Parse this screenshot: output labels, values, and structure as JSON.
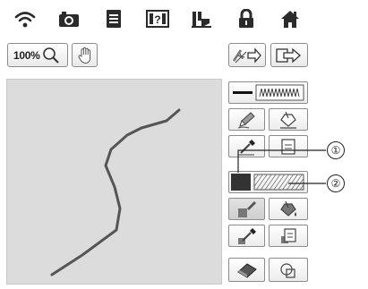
{
  "toolbar": {
    "icons": [
      "wifi-icon",
      "camera-icon",
      "document-icon",
      "help-icon",
      "sewing-machine-icon",
      "lock-icon",
      "home-icon"
    ]
  },
  "controls": {
    "zoom_label": "100%"
  },
  "callouts": {
    "first": "①",
    "second": "②"
  },
  "colors": {
    "stroke": "#555555",
    "canvas_bg": "#dcdcdc",
    "fill_swatch": "#333333"
  }
}
